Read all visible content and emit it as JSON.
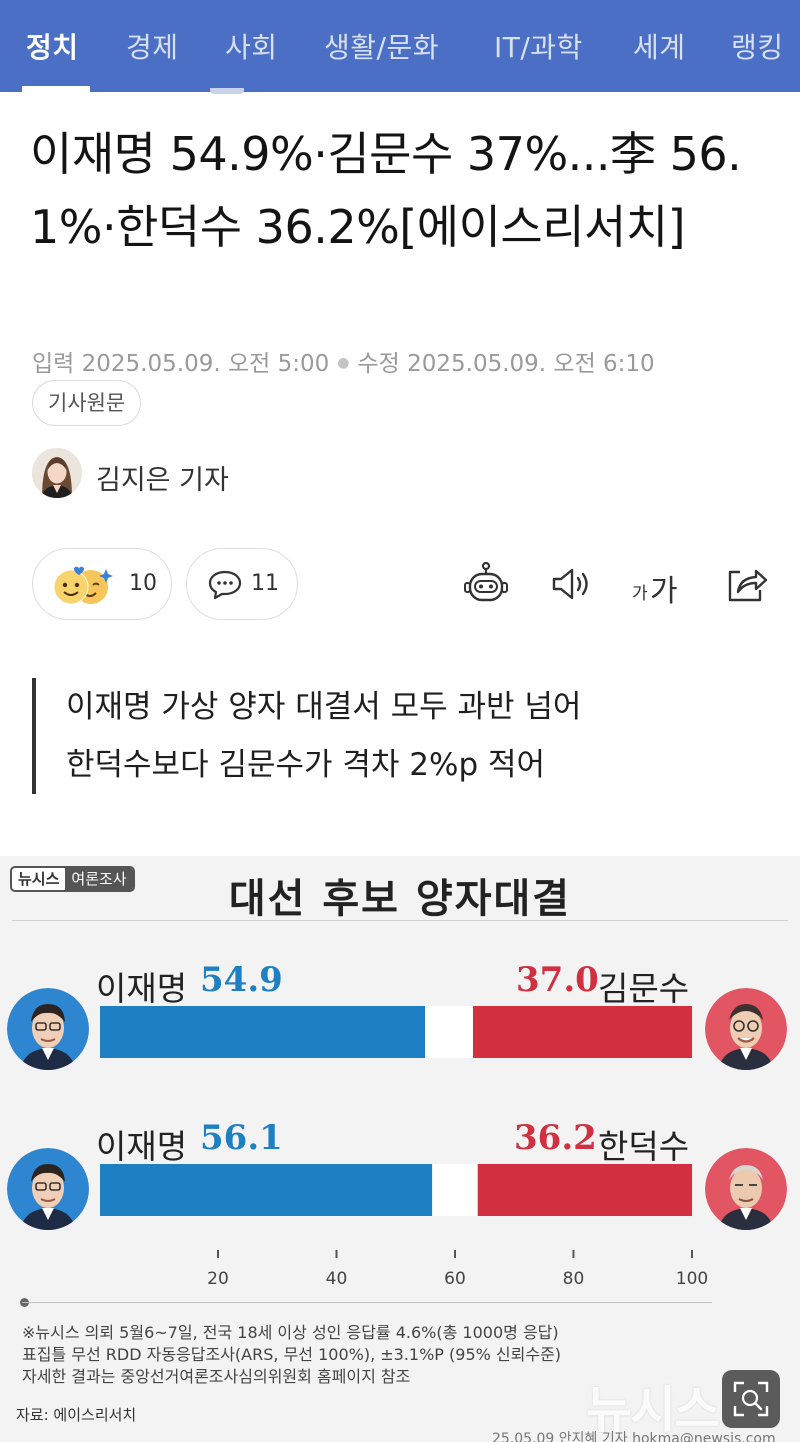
{
  "nav": {
    "tabs": [
      {
        "label": "정치",
        "active": true
      },
      {
        "label": "경제",
        "active": false
      },
      {
        "label": "사회",
        "active": false
      },
      {
        "label": "생활/문화",
        "active": false
      },
      {
        "label": "IT/과학",
        "active": false
      },
      {
        "label": "세계",
        "active": false
      },
      {
        "label": "랭킹",
        "active": false
      }
    ]
  },
  "article": {
    "headline": "이재명 54.9%·김문수 37%...李 56.1%·한덕수 36.2%[에이스리서치]",
    "input_label": "입력",
    "input_time": "2025.05.09. 오전 5:00",
    "edit_label": "수정",
    "edit_time": "2025.05.09. 오전 6:10",
    "original_link": "기사원문",
    "reporter": "김지은 기자",
    "reactions_count": "10",
    "comments_count": "11",
    "font_size_small": "가",
    "font_size_big": "가",
    "subheadings": [
      "이재명 가상 양자 대결서 모두 과반 넘어",
      "한덕수보다 김문수가 격차 2%p 적어"
    ]
  },
  "graphic": {
    "badge_left": "뉴시스",
    "badge_right": "여론조사",
    "title": "대선 후보 양자대결",
    "footnotes": [
      "※뉴시스 의뢰 5월6~7일, 전국 18세 이상 성인 응답률 4.6%(총 1000명 응답)",
      "표집틀 무선 RDD 자동응답조사(ARS, 무선 100%), ±3.1%P (95% 신뢰수준)",
      "자세한 결과는 중앙선거여론조사심의위원회 홈페이지 참조"
    ],
    "source": "자료: 에이스리서치",
    "credit": "25.05.09 안지혜 기자 hokma@newsis.com",
    "watermark": "뉴시스"
  },
  "colors": {
    "nav_bg": "#4b6fc4",
    "blue": "#1e7fc3",
    "red": "#d03040"
  },
  "chart_data": {
    "type": "bar",
    "title": "대선 후보 양자대결",
    "xlim": [
      0,
      100
    ],
    "ticks": [
      20,
      40,
      60,
      80,
      100
    ],
    "rows": [
      {
        "left_name": "이재명",
        "left_label": "54.9",
        "left_value": 54.9,
        "right_name": "김문수",
        "right_label": "37.0",
        "right_value": 37.0
      },
      {
        "left_name": "이재명",
        "left_label": "56.1",
        "left_value": 56.1,
        "right_name": "한덕수",
        "right_label": "36.2",
        "right_value": 36.2
      }
    ]
  }
}
